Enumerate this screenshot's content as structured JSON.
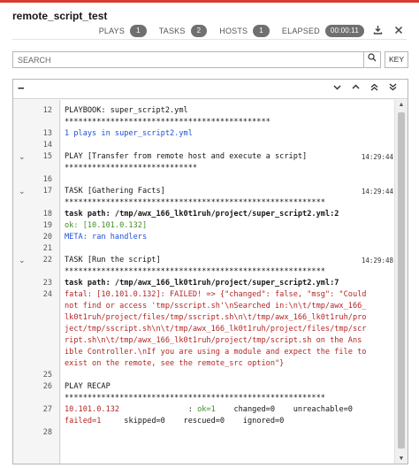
{
  "header": {
    "title": "remote_script_test",
    "stats": {
      "plays_label": "PLAYS",
      "plays_count": "1",
      "tasks_label": "TASKS",
      "tasks_count": "2",
      "hosts_label": "HOSTS",
      "hosts_count": "1",
      "elapsed_label": "ELAPSED",
      "elapsed_value": "00:00:11"
    },
    "icons": {
      "download": "download-icon",
      "close": "close-icon"
    }
  },
  "search": {
    "placeholder": "SEARCH",
    "button_icon": "search-icon",
    "key_label": "KEY"
  },
  "toolbar": {
    "collapse_label": "−",
    "nav_icons": [
      "chevron-down-icon",
      "chevron-up-icon",
      "double-chevron-up-icon",
      "double-chevron-down-icon"
    ]
  },
  "log": {
    "lines": [
      {
        "num": "12",
        "text": "PLAYBOOK: super_script2.yml",
        "style": ""
      },
      {
        "num": "",
        "text": "*********************************************",
        "style": ""
      },
      {
        "num": "13",
        "text": "1 plays in super_script2.yml",
        "style": "blue"
      },
      {
        "num": "14",
        "text": "",
        "style": ""
      },
      {
        "num": "15",
        "text": "PLAY [Transfer from remote host and execute a script]",
        "style": "",
        "ts": "14:29:44",
        "chevron": true
      },
      {
        "num": "",
        "text": "*****************************",
        "style": ""
      },
      {
        "num": "16",
        "text": "",
        "style": ""
      },
      {
        "num": "17",
        "text": "TASK [Gathering Facts]",
        "style": "",
        "ts": "14:29:44",
        "chevron": true
      },
      {
        "num": "",
        "text": "*********************************************************",
        "style": ""
      },
      {
        "num": "18",
        "text": "task path: /tmp/awx_166_lk0t1ruh/project/super_script2.yml:2",
        "style": "bold"
      },
      {
        "num": "19",
        "text": "ok: [10.101.0.132]",
        "style": "green"
      },
      {
        "num": "20",
        "text": "META: ran handlers",
        "style": "blue"
      },
      {
        "num": "21",
        "text": "",
        "style": ""
      },
      {
        "num": "22",
        "text": "TASK [Run the script]",
        "style": "",
        "ts": "14:29:48",
        "chevron": true
      },
      {
        "num": "",
        "text": "*********************************************************",
        "style": ""
      },
      {
        "num": "23",
        "text": "task path: /tmp/awx_166_lk0t1ruh/project/super_script2.yml:7",
        "style": "bold"
      },
      {
        "num": "24",
        "text": "fatal: [10.101.0.132]: FAILED! => {\"changed\": false, \"msg\": \"Could",
        "style": "red"
      },
      {
        "num": "",
        "text": "not find or access 'tmp/sscript.sh'\\nSearched in:\\n\\t/tmp/awx_166_",
        "style": "red"
      },
      {
        "num": "",
        "text": "lk0t1ruh/project/files/tmp/sscript.sh\\n\\t/tmp/awx_166_lk0t1ruh/pro",
        "style": "red"
      },
      {
        "num": "",
        "text": "ject/tmp/sscript.sh\\n\\t/tmp/awx_166_lk0t1ruh/project/files/tmp/scr",
        "style": "red"
      },
      {
        "num": "",
        "text": "ript.sh\\n\\t/tmp/awx_166_lk0t1ruh/project/tmp/script.sh on the Ans",
        "style": "red"
      },
      {
        "num": "",
        "text": "ible Controller.\\nIf you are using a module and expect the file to",
        "style": "red"
      },
      {
        "num": "",
        "text": "exist on the remote, see the remote_src option\"}",
        "style": "red"
      },
      {
        "num": "25",
        "text": "",
        "style": ""
      },
      {
        "num": "26",
        "text": "PLAY RECAP",
        "style": ""
      },
      {
        "num": "",
        "text": "*********************************************************",
        "style": ""
      },
      {
        "num": "27",
        "text": "10.101.0.132               : ok=1    changed=0    unreachable=0",
        "style": "",
        "segments": true
      },
      {
        "num": "",
        "text": "failed=1     skipped=0    rescued=0    ignored=0",
        "style": "",
        "segments2": true
      },
      {
        "num": "28",
        "text": "",
        "style": ""
      }
    ],
    "recap": {
      "host": "10.101.0.132",
      "sep": "               : ",
      "ok": "ok=1",
      "rest1": "    changed=0    unreachable=0",
      "failed": "failed=1",
      "rest2": "     skipped=0    rescued=0    ignored=0"
    }
  }
}
